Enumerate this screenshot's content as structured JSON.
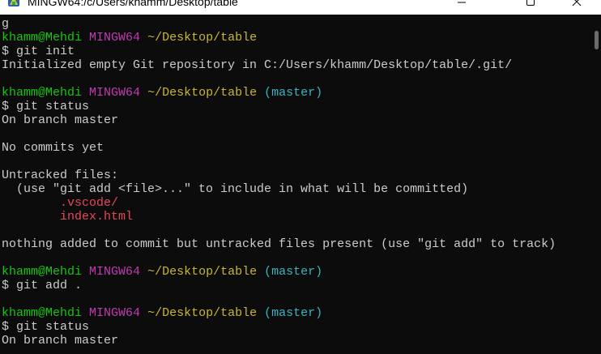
{
  "window": {
    "title": "MINGW64:/c/Users/khamm/Desktop/table",
    "app_icon": "mingw-icon",
    "controls": {
      "minimize": "minimize-icon",
      "maximize": "maximize-icon",
      "close": "close-icon"
    }
  },
  "colors": {
    "background": "#0c0c0c",
    "foreground": "#cccccc",
    "green": "#16c60c",
    "magenta": "#c239b3",
    "yellow": "#c8b82a",
    "cyan": "#3bb3c3",
    "red": "#e74856",
    "titlebar": "#ffffff",
    "title_text": "#000000",
    "scrollbar_thumb": "#6b6b6b"
  },
  "terminal": {
    "lines": [
      {
        "type": "output",
        "text": "g"
      },
      {
        "type": "prompt",
        "user_host": "khamm@Mehdi",
        "shell": "MINGW64",
        "cwd": "~/Desktop/table"
      },
      {
        "type": "command",
        "symbol": "$",
        "command": "git init"
      },
      {
        "type": "output",
        "text": "Initialized empty Git repository in C:/Users/khamm/Desktop/table/.git/"
      },
      {
        "type": "blank"
      },
      {
        "type": "prompt",
        "user_host": "khamm@Mehdi",
        "shell": "MINGW64",
        "cwd": "~/Desktop/table",
        "branch": "(master)"
      },
      {
        "type": "command",
        "symbol": "$",
        "command": "git status"
      },
      {
        "type": "output",
        "text": "On branch master"
      },
      {
        "type": "blank"
      },
      {
        "type": "output",
        "text": "No commits yet"
      },
      {
        "type": "blank"
      },
      {
        "type": "output",
        "text": "Untracked files:"
      },
      {
        "type": "hint",
        "text": "(use \"git add <file>...\" to include in what will be committed)"
      },
      {
        "type": "untracked_file",
        "text": ".vscode/",
        "color": "red"
      },
      {
        "type": "untracked_file",
        "text": "index.html",
        "color": "red"
      },
      {
        "type": "blank"
      },
      {
        "type": "output",
        "text": "nothing added to commit but untracked files present (use \"git add\" to track)"
      },
      {
        "type": "blank"
      },
      {
        "type": "prompt",
        "user_host": "khamm@Mehdi",
        "shell": "MINGW64",
        "cwd": "~/Desktop/table",
        "branch": "(master)"
      },
      {
        "type": "command",
        "symbol": "$",
        "command": "git add ."
      },
      {
        "type": "blank"
      },
      {
        "type": "prompt",
        "user_host": "khamm@Mehdi",
        "shell": "MINGW64",
        "cwd": "~/Desktop/table",
        "branch": "(master)"
      },
      {
        "type": "command",
        "symbol": "$",
        "command": "git status"
      },
      {
        "type": "output",
        "text": "On branch master"
      }
    ]
  }
}
